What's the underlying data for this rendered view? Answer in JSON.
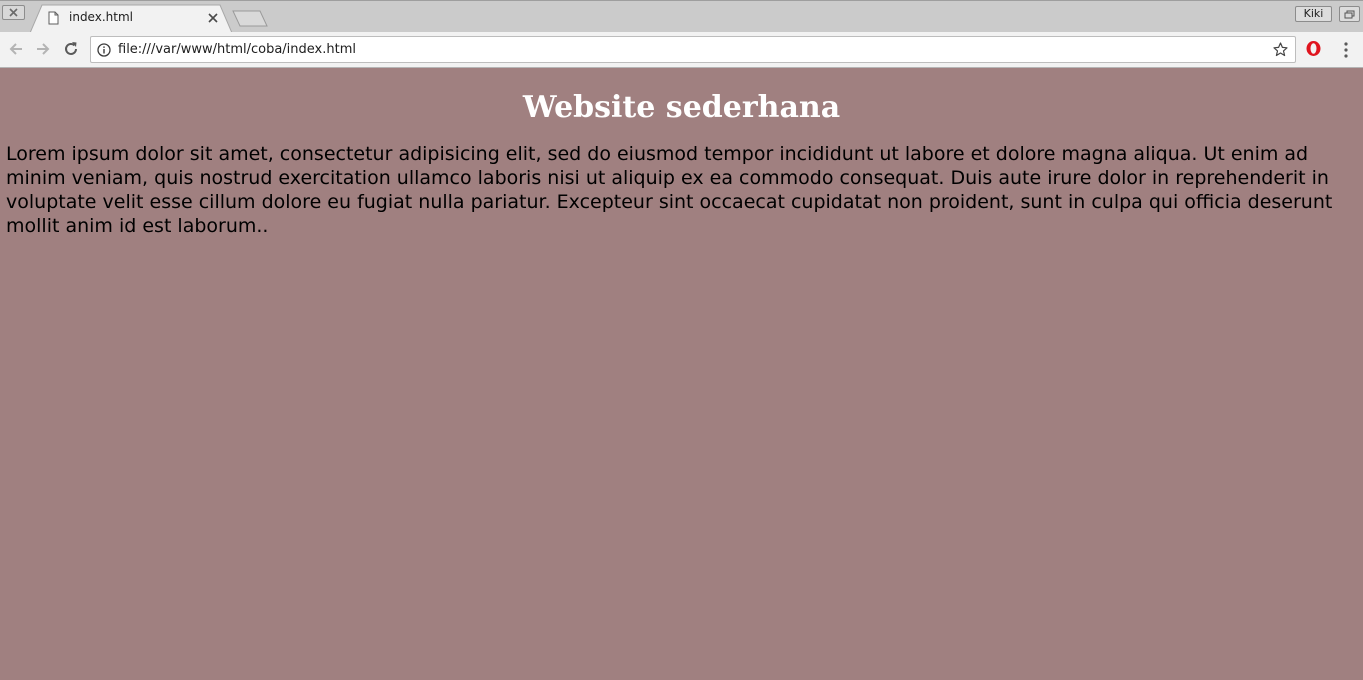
{
  "browser": {
    "tab": {
      "title": "index.html"
    },
    "profile": {
      "name": "Kiki"
    },
    "address_bar": {
      "url": "file:///var/www/html/coba/index.html"
    }
  },
  "page": {
    "heading": "Website sederhana",
    "paragraph": "Lorem ipsum dolor sit amet, consectetur adipisicing elit, sed do eiusmod tempor incididunt ut labore et dolore magna aliqua. Ut enim ad minim veniam, quis nostrud exercitation ullamco laboris nisi ut aliquip ex ea commodo consequat. Duis aute irure dolor in reprehenderit in voluptate velit esse cillum dolore eu fugiat nulla pariatur. Excepteur sint occaecat cupidatat non proident, sunt in culpa qui officia deserunt mollit anim id est laborum.."
  },
  "colors": {
    "page_background": "#a08080",
    "heading": "#ffffff",
    "text": "#000000",
    "opera_red": "#e0141e"
  },
  "icons": [
    "close-window-icon",
    "document-icon",
    "close-icon",
    "new-tab-icon",
    "restore-icon",
    "back-arrow-icon",
    "forward-arrow-icon",
    "reload-icon",
    "info-icon",
    "star-icon",
    "opera-icon",
    "menu-dots-icon"
  ]
}
